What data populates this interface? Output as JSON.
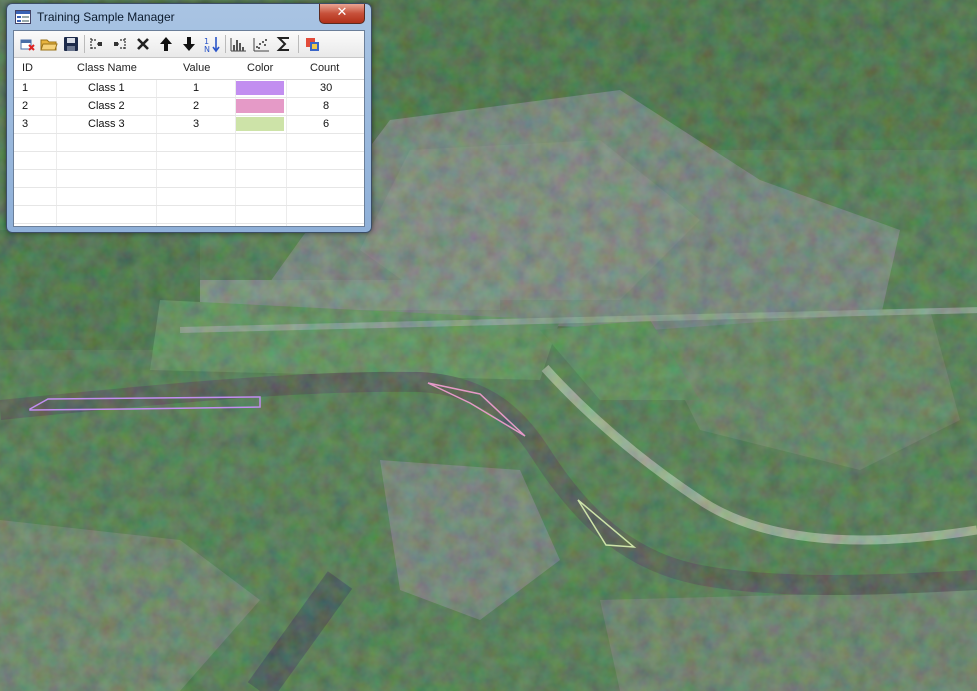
{
  "window": {
    "title": "Training Sample Manager",
    "close_label": "✕"
  },
  "toolbar": {
    "icons": [
      "new-icon",
      "open-icon",
      "save-icon",
      "merge-icon",
      "split-icon",
      "delete-icon",
      "move-up-icon",
      "move-down-icon",
      "sort-icon",
      "histogram-icon",
      "scatterplot-icon",
      "statistics-icon",
      "evaluate-icon"
    ]
  },
  "table": {
    "headers": {
      "id": "ID",
      "class_name": "Class Name",
      "value": "Value",
      "color": "Color",
      "count": "Count"
    },
    "rows": [
      {
        "id": "1",
        "class_name": "Class 1",
        "value": "1",
        "color": "#c28ef0",
        "count": "30"
      },
      {
        "id": "2",
        "class_name": "Class 2",
        "value": "2",
        "color": "#e59ac7",
        "count": "8"
      },
      {
        "id": "3",
        "class_name": "Class 3",
        "value": "3",
        "color": "#cde3a8",
        "count": "6"
      }
    ]
  },
  "samples": [
    {
      "class_id": "1",
      "stroke": "#c28ef0"
    },
    {
      "class_id": "2",
      "stroke": "#e59ac7"
    },
    {
      "class_id": "3",
      "stroke": "#cde3a8"
    }
  ]
}
